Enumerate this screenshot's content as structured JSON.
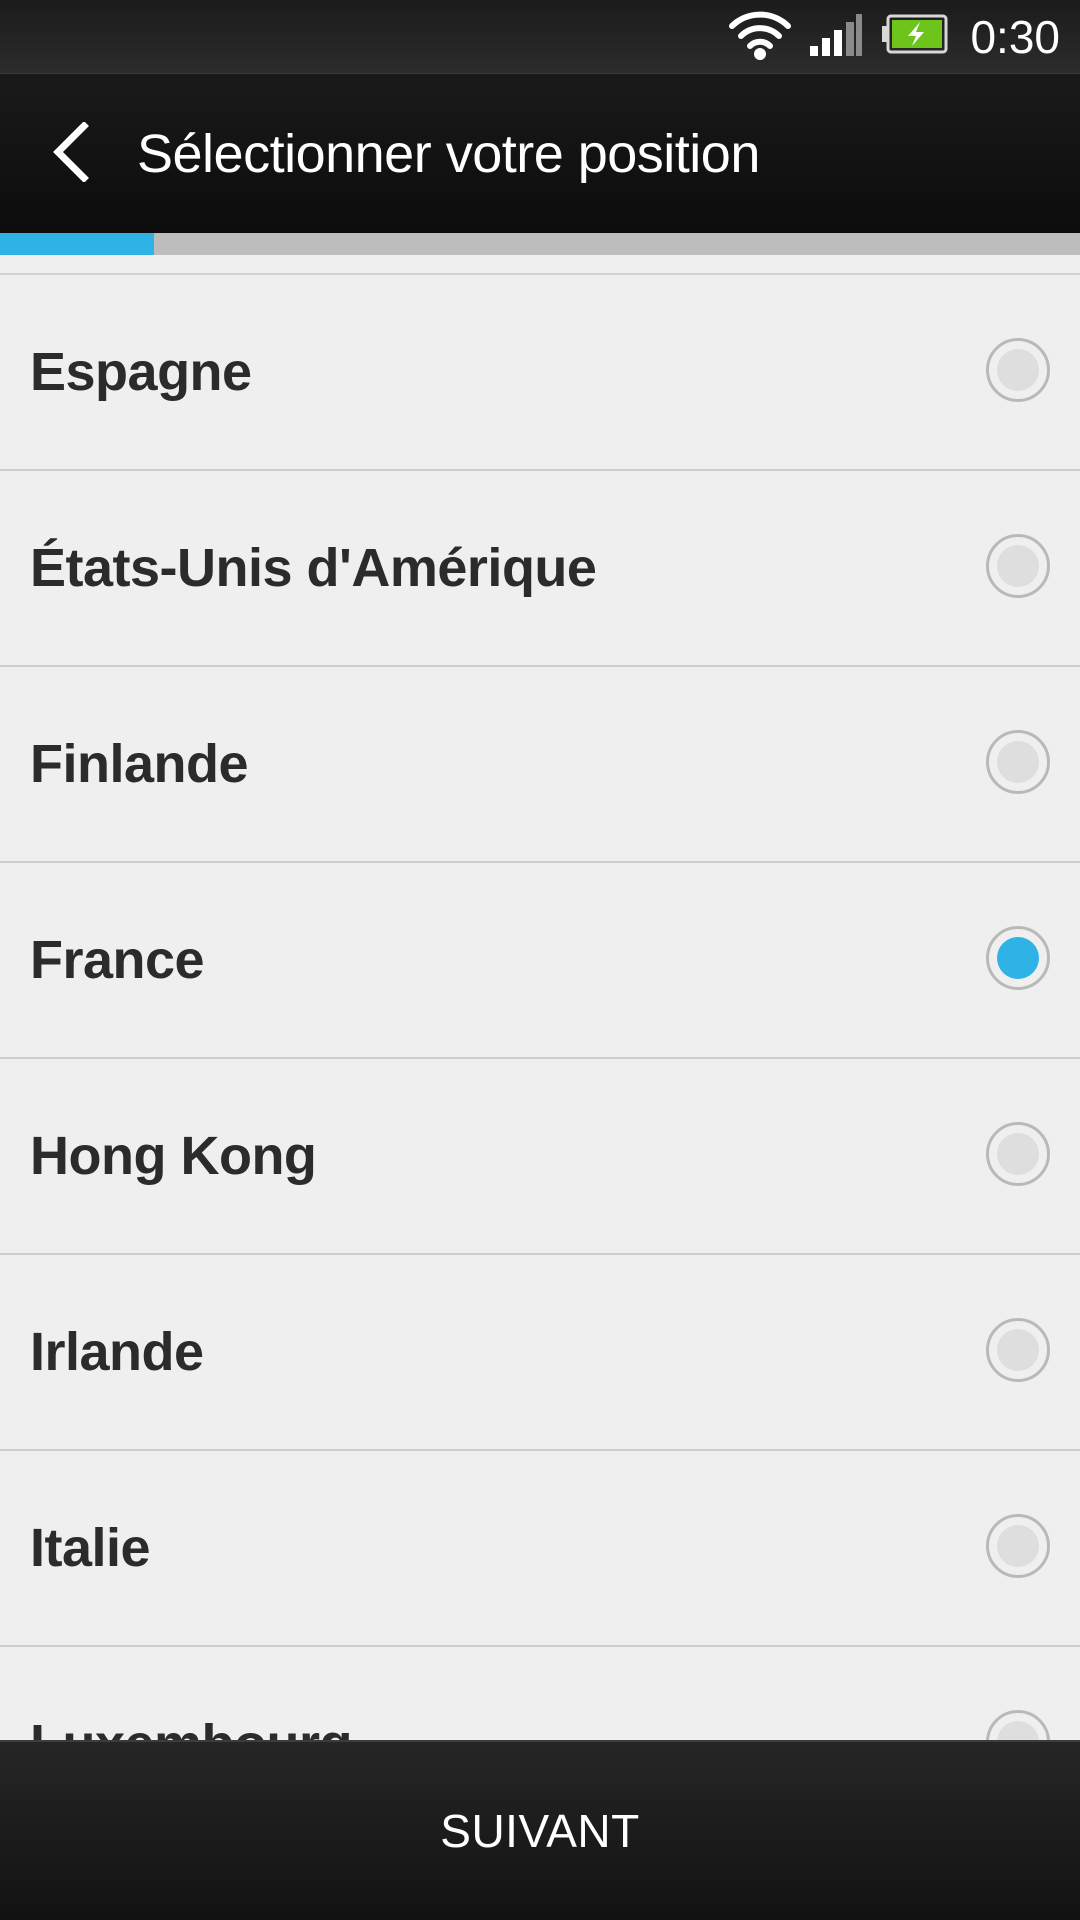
{
  "status_bar": {
    "time": "0:30",
    "icons": [
      "wifi-icon",
      "signal-icon",
      "battery-charging-icon"
    ]
  },
  "action_bar": {
    "title": "Sélectionner votre position",
    "back_icon": "chevron-left-icon"
  },
  "progress": {
    "value": 0.143
  },
  "list": {
    "items": [
      {
        "label": "Espagne",
        "selected": false
      },
      {
        "label": "États-Unis d'Amérique",
        "selected": false
      },
      {
        "label": "Finlande",
        "selected": false
      },
      {
        "label": "France",
        "selected": true
      },
      {
        "label": "Hong Kong",
        "selected": false
      },
      {
        "label": "Irlande",
        "selected": false
      },
      {
        "label": "Italie",
        "selected": false
      },
      {
        "label": "Luxembourg",
        "selected": false
      }
    ]
  },
  "bottom_bar": {
    "next_label": "SUIVANT"
  },
  "colors": {
    "accent": "#2fb3e6",
    "battery": "#6dc41a"
  }
}
